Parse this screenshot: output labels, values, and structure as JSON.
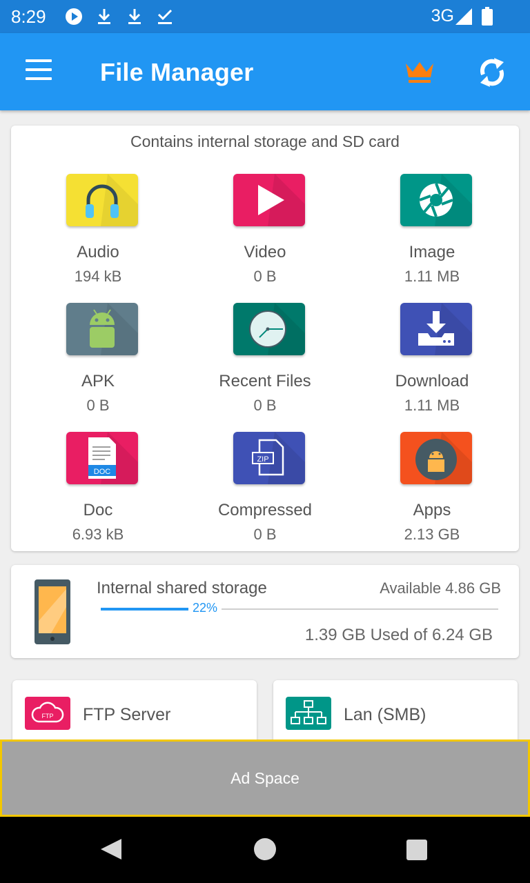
{
  "status_bar": {
    "time": "8:29",
    "network": "3G"
  },
  "app_bar": {
    "title": "File Manager"
  },
  "categories": {
    "caption": "Contains internal storage and SD card",
    "items": [
      {
        "label": "Audio",
        "size": "194 kB",
        "icon": "headphones-icon",
        "color": "#f5e033"
      },
      {
        "label": "Video",
        "size": "0 B",
        "icon": "play-icon",
        "color": "#e91e63"
      },
      {
        "label": "Image",
        "size": "1.11 MB",
        "icon": "camera-aperture-icon",
        "color": "#009688"
      },
      {
        "label": "APK",
        "size": "0 B",
        "icon": "android-icon",
        "color": "#607d8b"
      },
      {
        "label": "Recent Files",
        "size": "0 B",
        "icon": "clock-icon",
        "color": "#00796b"
      },
      {
        "label": "Download",
        "size": "1.11 MB",
        "icon": "download-icon",
        "color": "#3f51b5"
      },
      {
        "label": "Doc",
        "size": "6.93 kB",
        "icon": "doc-icon",
        "color": "#e91e63"
      },
      {
        "label": "Compressed",
        "size": "0 B",
        "icon": "zip-icon",
        "color": "#3f51b5"
      },
      {
        "label": "Apps",
        "size": "2.13 GB",
        "icon": "apps-icon",
        "color": "#f4511e"
      }
    ]
  },
  "storage": {
    "name": "Internal shared storage",
    "available": "Available 4.86 GB",
    "percent_label": "22%",
    "percent": 22,
    "used": "1.39 GB Used of 6.24 GB"
  },
  "tools": {
    "ftp_label": "FTP Server",
    "ftp_icon_text": "FTP",
    "lan_label": "Lan (SMB)"
  },
  "ad": {
    "label": "Ad Space"
  },
  "colors": {
    "primary": "#2196f3",
    "primary_dark": "#1c7fd6",
    "accent_crown": "#ff7f0f"
  }
}
